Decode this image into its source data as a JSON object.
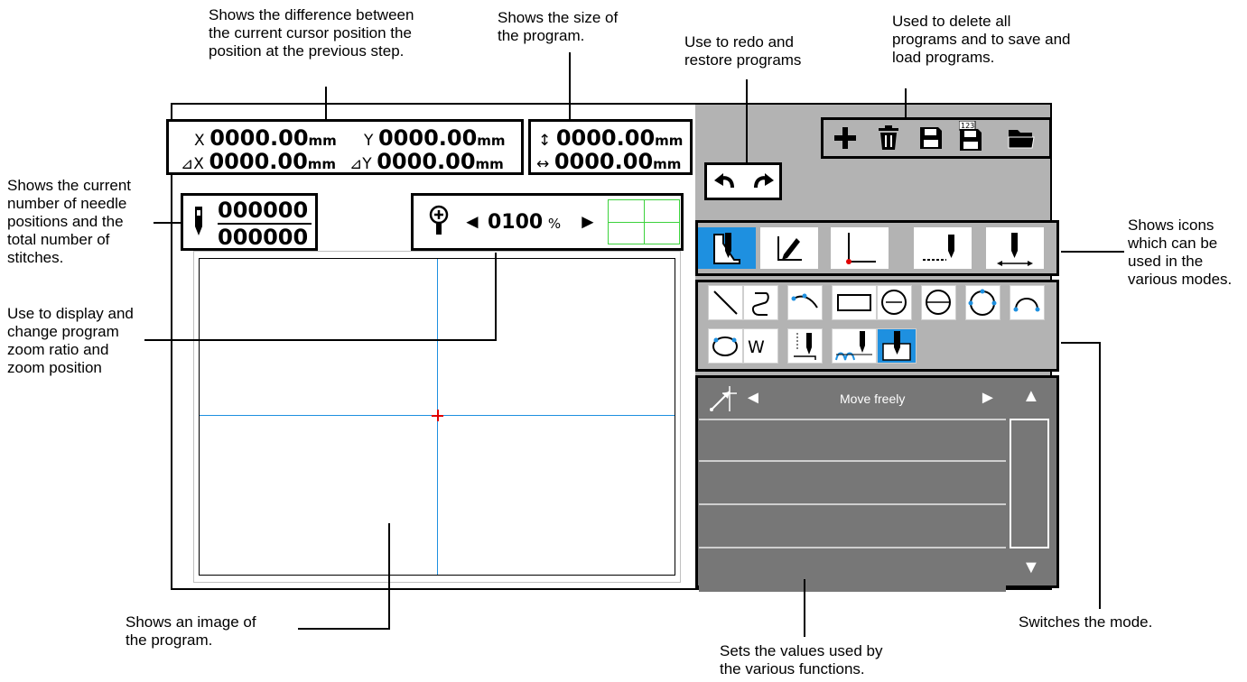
{
  "annotations": {
    "cursor_diff": "Shows the difference between\nthe current cursor position the\nposition at the previous step.",
    "program_size": "Shows the size of\nthe program.",
    "redo_restore": "Use to redo and\nrestore programs",
    "delete_save_load": "Used to delete all\nprograms and to save and\nload programs.",
    "needle_positions": "Shows the current\nnumber of needle\npositions and the\ntotal number of\nstitches.",
    "mode_icons": "Shows icons\nwhich can be\nused in the\nvarious modes.",
    "zoom": "Use to display and\nchange program\nzoom ratio and\nzoom position",
    "program_image": "Shows an image of\nthe program.",
    "values": "Sets the values used by\nthe various functions.",
    "switch_mode": "Switches the mode."
  },
  "coords": {
    "x_label": "X",
    "x_value": "0000.00",
    "x_unit": "mm",
    "y_label": "Y",
    "y_value": "0000.00",
    "y_unit": "mm",
    "dx_label": "⊿X",
    "dx_value": "0000.00",
    "dx_unit": "mm",
    "dy_label": "⊿Y",
    "dy_value": "0000.00",
    "dy_unit": "mm"
  },
  "size": {
    "height_value": "0000.00",
    "height_unit": "mm",
    "width_value": "0000.00",
    "width_unit": "mm"
  },
  "stitch_counter": {
    "current": "000000",
    "total": "000000"
  },
  "zoom": {
    "value": "0100",
    "unit": "%",
    "left_arrow": "◄",
    "right_arrow": "►"
  },
  "value_panel": {
    "selected_label": "Move freely",
    "left_arrow": "◄",
    "right_arrow": "►",
    "scroll_up": "▲",
    "scroll_down": "▼"
  },
  "toolbar_icons": [
    "plus-icon",
    "trash-icon",
    "save-icon",
    "save-numbered-icon",
    "folder-open-icon"
  ],
  "colors": {
    "accent": "#1e90e0",
    "panel_gray": "#b3b3b3",
    "list_gray": "#777777",
    "cursor_red": "#e00000",
    "crosshair_blue": "#1e90e0",
    "zoom_green": "#3cd23c"
  }
}
